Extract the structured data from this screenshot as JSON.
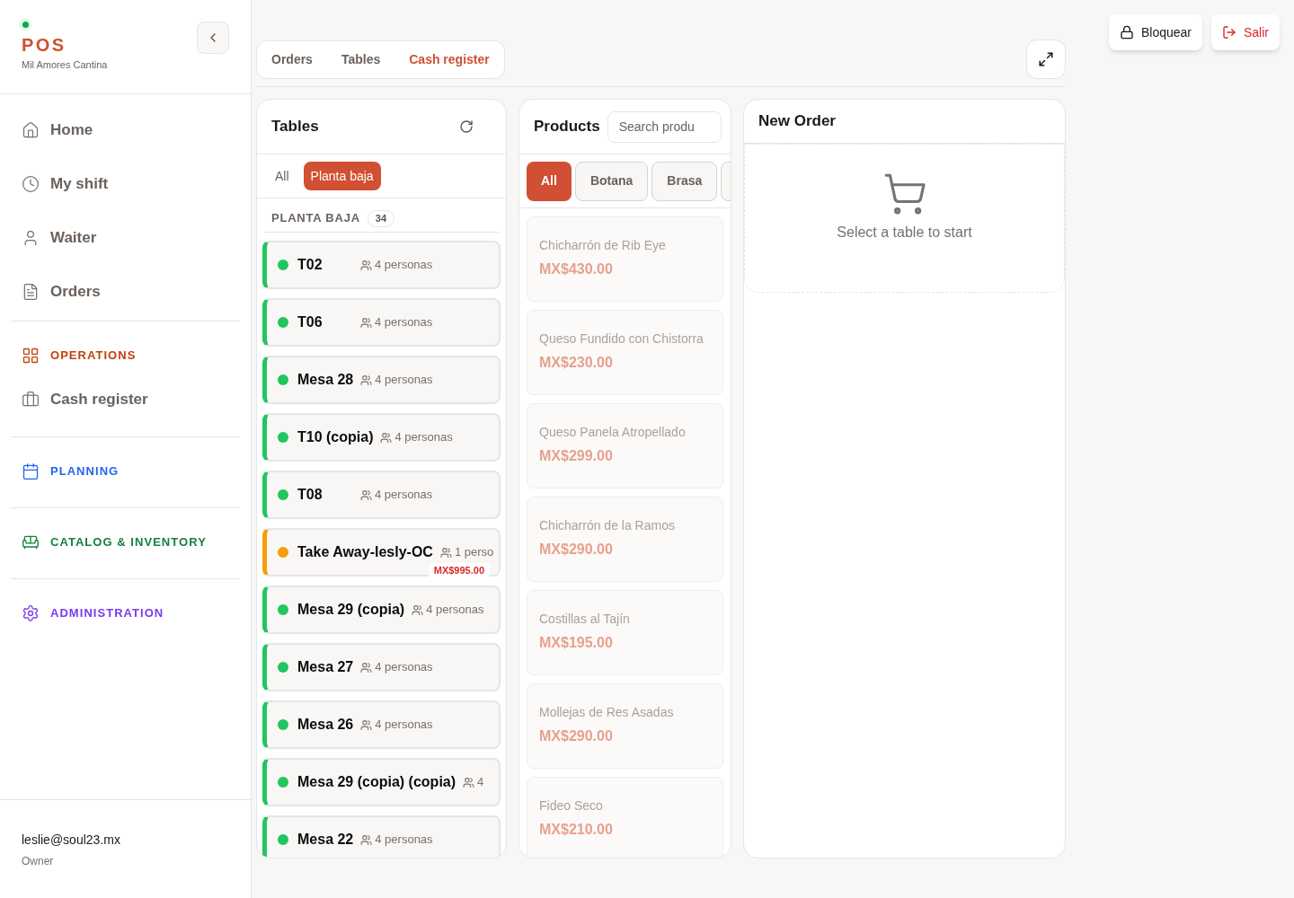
{
  "sidebar": {
    "brand": {
      "title": "POS",
      "subtitle": "Mil Amores Cantina",
      "online": true
    },
    "nav": [
      {
        "label": "Home"
      },
      {
        "label": "My shift"
      },
      {
        "label": "Waiter"
      },
      {
        "label": "Orders"
      }
    ],
    "sections": [
      {
        "title": "OPERATIONS",
        "color": "#c2410c",
        "items": [
          {
            "label": "Cash register"
          }
        ]
      },
      {
        "title": "PLANNING",
        "color": "#2563eb"
      },
      {
        "title": "CATALOG & INVENTORY",
        "color": "#15803d"
      },
      {
        "title": "ADMINISTRATION",
        "color": "#7c3aed"
      }
    ],
    "user": {
      "email": "leslie@soul23.mx",
      "role": "Owner"
    }
  },
  "tabs": [
    {
      "label": "Orders",
      "selected": false
    },
    {
      "label": "Tables",
      "selected": false
    },
    {
      "label": "Cash register",
      "selected": true
    }
  ],
  "top_actions": [
    {
      "label": "Bloquear",
      "kind": "lock"
    },
    {
      "label": "Salir",
      "kind": "logout"
    }
  ],
  "tables_panel": {
    "title": "Tables",
    "filters": [
      {
        "label": "All",
        "selected": false
      },
      {
        "label": "Planta baja",
        "selected": true
      }
    ],
    "group": {
      "title": "PLANTA BAJA",
      "count": "34"
    },
    "rows": [
      {
        "name": "T02",
        "guests": "4 personas",
        "color": "#22c55e"
      },
      {
        "name": "T06",
        "guests": "4 personas",
        "color": "#22c55e"
      },
      {
        "name": "Mesa 28",
        "guests": "4 personas",
        "color": "#22c55e"
      },
      {
        "name": "T10 (copia)",
        "guests": "4 personas",
        "color": "#22c55e"
      },
      {
        "name": "T08",
        "guests": "4 personas",
        "color": "#22c55e"
      },
      {
        "name": "Take Away-lesly-OC",
        "guests": "1 perso",
        "color": "#f59e0b",
        "amount": "MX$995.00"
      },
      {
        "name": "Mesa 29 (copia)",
        "guests": "4 personas",
        "color": "#22c55e"
      },
      {
        "name": "Mesa 27",
        "guests": "4 personas",
        "color": "#22c55e"
      },
      {
        "name": "Mesa 26",
        "guests": "4 personas",
        "color": "#22c55e"
      },
      {
        "name": "Mesa 29 (copia) (copia)",
        "guests": "4",
        "color": "#22c55e"
      },
      {
        "name": "Mesa 22",
        "guests": "4 personas",
        "color": "#22c55e"
      }
    ]
  },
  "products_panel": {
    "title": "Products",
    "search": {
      "placeholder": "Search produ"
    },
    "categories": [
      {
        "label": "All",
        "selected": true
      },
      {
        "label": "Botana",
        "selected": false
      },
      {
        "label": "Brasa",
        "selected": false
      }
    ],
    "items": [
      {
        "name": "Chicharrón de Rib Eye",
        "price": "MX$430.00"
      },
      {
        "name": "Queso Fundido con Chistorra",
        "price": "MX$230.00"
      },
      {
        "name": "Queso Panela Atropellado",
        "price": "MX$299.00"
      },
      {
        "name": "Chicharrón de la Ramos",
        "price": "MX$290.00"
      },
      {
        "name": "Costillas al Tajín",
        "price": "MX$195.00"
      },
      {
        "name": "Mollejas de Res Asadas",
        "price": "MX$290.00"
      },
      {
        "name": "Fideo Seco",
        "price": "MX$210.00"
      }
    ]
  },
  "order_panel": {
    "title": "New Order",
    "empty_message": "Select a table to start"
  }
}
